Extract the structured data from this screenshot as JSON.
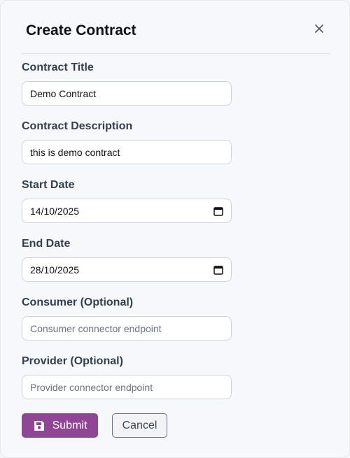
{
  "modal": {
    "title": "Create Contract",
    "close_icon": "close-icon"
  },
  "fields": {
    "title": {
      "label": "Contract Title",
      "value": "Demo Contract"
    },
    "description": {
      "label": "Contract Description",
      "value": "this is demo contract"
    },
    "start_date": {
      "label": "Start Date",
      "value": "14/10/2025",
      "icon": "calendar-icon"
    },
    "end_date": {
      "label": "End Date",
      "value": "28/10/2025",
      "icon": "calendar-icon"
    },
    "consumer": {
      "label": "Consumer (Optional)",
      "placeholder": "Consumer connector endpoint"
    },
    "provider": {
      "label": "Provider (Optional)",
      "placeholder": "Provider connector endpoint"
    }
  },
  "actions": {
    "submit_label": "Submit",
    "submit_icon": "save-icon",
    "cancel_label": "Cancel"
  },
  "colors": {
    "primary": "#914695",
    "label": "#34404f",
    "border": "#cfd4da"
  }
}
